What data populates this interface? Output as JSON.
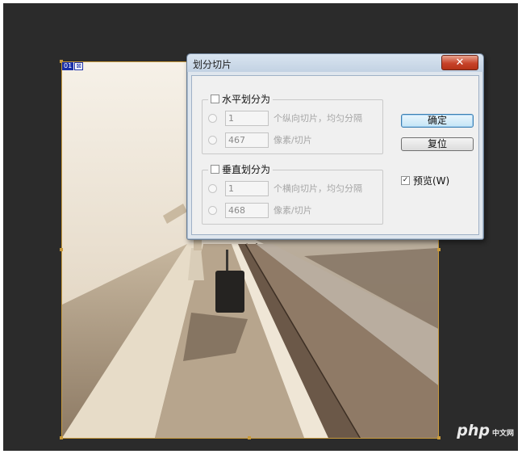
{
  "canvas": {
    "slice_badge": "01",
    "slice_icon": "image-slice-icon"
  },
  "dialog": {
    "title": "划分切片",
    "close_symbol": "✕",
    "horizontal": {
      "label": "水平划分为",
      "checked": false,
      "count_value": "1",
      "count_suffix": "个纵向切片，均匀分隔",
      "pixel_value": "467",
      "pixel_suffix": "像素/切片"
    },
    "vertical": {
      "label": "垂直划分为",
      "checked": false,
      "count_value": "1",
      "count_suffix": "个横向切片，均匀分隔",
      "pixel_value": "468",
      "pixel_suffix": "像素/切片"
    },
    "ok_label": "确定",
    "reset_label": "复位",
    "preview_label": "预览(W)",
    "preview_checked": true,
    "check_mark": "✓"
  },
  "watermark": {
    "brand": "php",
    "suffix": "中文网"
  },
  "colors": {
    "workspace": "#2b2b2b",
    "dialog_bg": "#f0f0f0",
    "close_button": "#c7432a",
    "slice_badge": "#1a2fa8",
    "slice_border": "#c89a3c"
  }
}
